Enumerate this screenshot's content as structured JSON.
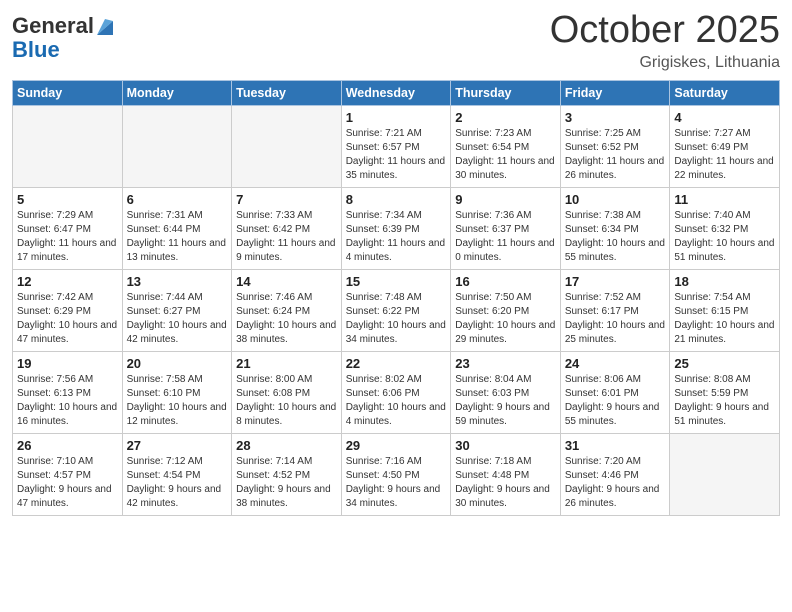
{
  "header": {
    "logo_general": "General",
    "logo_blue": "Blue",
    "month_title": "October 2025",
    "location": "Grigiskes, Lithuania"
  },
  "days_of_week": [
    "Sunday",
    "Monday",
    "Tuesday",
    "Wednesday",
    "Thursday",
    "Friday",
    "Saturday"
  ],
  "weeks": [
    [
      {
        "day": "",
        "empty": true
      },
      {
        "day": "",
        "empty": true
      },
      {
        "day": "",
        "empty": true
      },
      {
        "day": "1",
        "sunrise": "7:21 AM",
        "sunset": "6:57 PM",
        "daylight": "11 hours and 35 minutes."
      },
      {
        "day": "2",
        "sunrise": "7:23 AM",
        "sunset": "6:54 PM",
        "daylight": "11 hours and 30 minutes."
      },
      {
        "day": "3",
        "sunrise": "7:25 AM",
        "sunset": "6:52 PM",
        "daylight": "11 hours and 26 minutes."
      },
      {
        "day": "4",
        "sunrise": "7:27 AM",
        "sunset": "6:49 PM",
        "daylight": "11 hours and 22 minutes."
      }
    ],
    [
      {
        "day": "5",
        "sunrise": "7:29 AM",
        "sunset": "6:47 PM",
        "daylight": "11 hours and 17 minutes."
      },
      {
        "day": "6",
        "sunrise": "7:31 AM",
        "sunset": "6:44 PM",
        "daylight": "11 hours and 13 minutes."
      },
      {
        "day": "7",
        "sunrise": "7:33 AM",
        "sunset": "6:42 PM",
        "daylight": "11 hours and 9 minutes."
      },
      {
        "day": "8",
        "sunrise": "7:34 AM",
        "sunset": "6:39 PM",
        "daylight": "11 hours and 4 minutes."
      },
      {
        "day": "9",
        "sunrise": "7:36 AM",
        "sunset": "6:37 PM",
        "daylight": "11 hours and 0 minutes."
      },
      {
        "day": "10",
        "sunrise": "7:38 AM",
        "sunset": "6:34 PM",
        "daylight": "10 hours and 55 minutes."
      },
      {
        "day": "11",
        "sunrise": "7:40 AM",
        "sunset": "6:32 PM",
        "daylight": "10 hours and 51 minutes."
      }
    ],
    [
      {
        "day": "12",
        "sunrise": "7:42 AM",
        "sunset": "6:29 PM",
        "daylight": "10 hours and 47 minutes."
      },
      {
        "day": "13",
        "sunrise": "7:44 AM",
        "sunset": "6:27 PM",
        "daylight": "10 hours and 42 minutes."
      },
      {
        "day": "14",
        "sunrise": "7:46 AM",
        "sunset": "6:24 PM",
        "daylight": "10 hours and 38 minutes."
      },
      {
        "day": "15",
        "sunrise": "7:48 AM",
        "sunset": "6:22 PM",
        "daylight": "10 hours and 34 minutes."
      },
      {
        "day": "16",
        "sunrise": "7:50 AM",
        "sunset": "6:20 PM",
        "daylight": "10 hours and 29 minutes."
      },
      {
        "day": "17",
        "sunrise": "7:52 AM",
        "sunset": "6:17 PM",
        "daylight": "10 hours and 25 minutes."
      },
      {
        "day": "18",
        "sunrise": "7:54 AM",
        "sunset": "6:15 PM",
        "daylight": "10 hours and 21 minutes."
      }
    ],
    [
      {
        "day": "19",
        "sunrise": "7:56 AM",
        "sunset": "6:13 PM",
        "daylight": "10 hours and 16 minutes."
      },
      {
        "day": "20",
        "sunrise": "7:58 AM",
        "sunset": "6:10 PM",
        "daylight": "10 hours and 12 minutes."
      },
      {
        "day": "21",
        "sunrise": "8:00 AM",
        "sunset": "6:08 PM",
        "daylight": "10 hours and 8 minutes."
      },
      {
        "day": "22",
        "sunrise": "8:02 AM",
        "sunset": "6:06 PM",
        "daylight": "10 hours and 4 minutes."
      },
      {
        "day": "23",
        "sunrise": "8:04 AM",
        "sunset": "6:03 PM",
        "daylight": "9 hours and 59 minutes."
      },
      {
        "day": "24",
        "sunrise": "8:06 AM",
        "sunset": "6:01 PM",
        "daylight": "9 hours and 55 minutes."
      },
      {
        "day": "25",
        "sunrise": "8:08 AM",
        "sunset": "5:59 PM",
        "daylight": "9 hours and 51 minutes."
      }
    ],
    [
      {
        "day": "26",
        "sunrise": "7:10 AM",
        "sunset": "4:57 PM",
        "daylight": "9 hours and 47 minutes."
      },
      {
        "day": "27",
        "sunrise": "7:12 AM",
        "sunset": "4:54 PM",
        "daylight": "9 hours and 42 minutes."
      },
      {
        "day": "28",
        "sunrise": "7:14 AM",
        "sunset": "4:52 PM",
        "daylight": "9 hours and 38 minutes."
      },
      {
        "day": "29",
        "sunrise": "7:16 AM",
        "sunset": "4:50 PM",
        "daylight": "9 hours and 34 minutes."
      },
      {
        "day": "30",
        "sunrise": "7:18 AM",
        "sunset": "4:48 PM",
        "daylight": "9 hours and 30 minutes."
      },
      {
        "day": "31",
        "sunrise": "7:20 AM",
        "sunset": "4:46 PM",
        "daylight": "9 hours and 26 minutes."
      },
      {
        "day": "",
        "empty": true
      }
    ]
  ]
}
